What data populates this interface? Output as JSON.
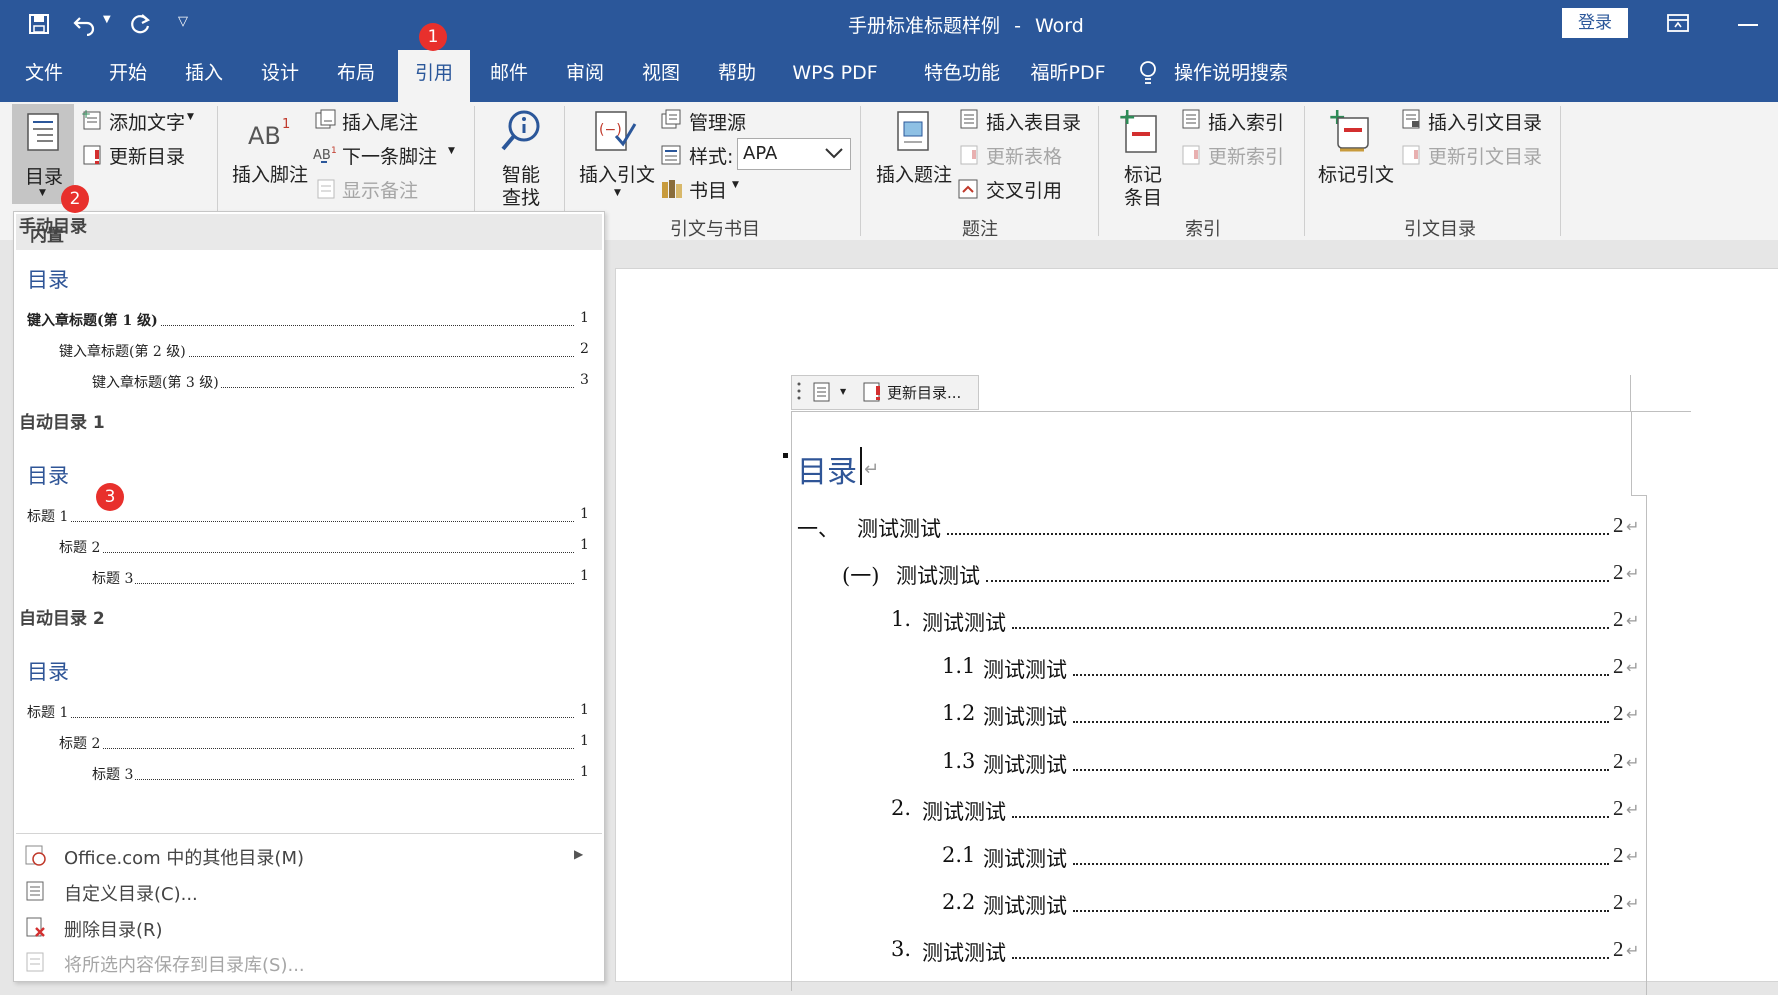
{
  "titlebar": {
    "document_title": "手册标准标题样例",
    "separator": "-",
    "app_name": "Word",
    "login_label": "登录"
  },
  "tabs": [
    "文件",
    "开始",
    "插入",
    "设计",
    "布局",
    "引用",
    "邮件",
    "审阅",
    "视图",
    "帮助",
    "WPS PDF",
    "特色功能",
    "福昕PDF",
    "操作说明搜索"
  ],
  "active_tab": "引用",
  "ribbon": {
    "toc": {
      "button": "目录",
      "add_text": "添加文字",
      "update_toc": "更新目录"
    },
    "footnotes": {
      "insert_footnote": "插入脚注",
      "insert_endnote": "插入尾注",
      "next_footnote": "下一条脚注",
      "show_notes": "显示备注"
    },
    "research": {
      "smart_lookup_line1": "智能",
      "smart_lookup_line2": "查找"
    },
    "citations": {
      "insert_citation": "插入引文",
      "manage_sources": "管理源",
      "style_label": "样式:",
      "style_value": "APA",
      "bibliography": "书目",
      "group_label": "引文与书目"
    },
    "captions": {
      "insert_caption": "插入题注",
      "insert_table_of_figures": "插入表目录",
      "update_table": "更新表格",
      "cross_reference": "交叉引用",
      "group_label": "题注"
    },
    "index": {
      "mark_entry_line1": "标记",
      "mark_entry_line2": "条目",
      "insert_index": "插入索引",
      "update_index": "更新索引",
      "group_label": "索引"
    },
    "authorities": {
      "mark_citation": "标记引文",
      "insert_toa": "插入引文目录",
      "update_toa": "更新引文目录",
      "group_label": "引文目录"
    }
  },
  "badges": [
    "1",
    "2",
    "3"
  ],
  "dropdown": {
    "header": "内置",
    "sections": [
      {
        "name": "手动目录",
        "heading": "目录",
        "entries": [
          {
            "text": "键入章标题(第 1 级)",
            "page": "1"
          },
          {
            "text": "键入章标题(第 2 级)",
            "page": "2"
          },
          {
            "text": "键入章标题(第 3 级)",
            "page": "3"
          }
        ]
      },
      {
        "name": "自动目录 1",
        "heading": "目录",
        "entries": [
          {
            "text": "标题 1",
            "page": "1"
          },
          {
            "text": "标题 2",
            "page": "1"
          },
          {
            "text": "标题 3",
            "page": "1"
          }
        ]
      },
      {
        "name": "自动目录 2",
        "heading": "目录",
        "entries": [
          {
            "text": "标题 1",
            "page": "1"
          },
          {
            "text": "标题 2",
            "page": "1"
          },
          {
            "text": "标题 3",
            "page": "1"
          }
        ]
      }
    ],
    "menu": [
      {
        "label": "Office.com 中的其他目录(M)"
      },
      {
        "label": "自定义目录(C)..."
      },
      {
        "label": "删除目录(R)"
      },
      {
        "label": "将所选内容保存到目录库(S)..."
      }
    ]
  },
  "document": {
    "control_update_label": "更新目录...",
    "toc_title": "目录",
    "entries": [
      {
        "number": "一、",
        "text": "测试测试",
        "page": "2"
      },
      {
        "number": "(一)",
        "text": "测试测试",
        "page": "2"
      },
      {
        "number": "1.",
        "text": "测试测试",
        "page": "2"
      },
      {
        "number": "1.1",
        "text": "测试测试",
        "page": "2"
      },
      {
        "number": "1.2",
        "text": "测试测试",
        "page": "2"
      },
      {
        "number": "1.3",
        "text": "测试测试",
        "page": "2"
      },
      {
        "number": "2.",
        "text": "测试测试",
        "page": "2"
      },
      {
        "number": "2.1",
        "text": "测试测试",
        "page": "2"
      },
      {
        "number": "2.2",
        "text": "测试测试",
        "page": "2"
      },
      {
        "number": "3.",
        "text": "测试测试",
        "page": "2"
      }
    ]
  },
  "colors": {
    "brand": "#2b579a",
    "badge": "#e8302c",
    "toc_heading": "#2f5597"
  }
}
